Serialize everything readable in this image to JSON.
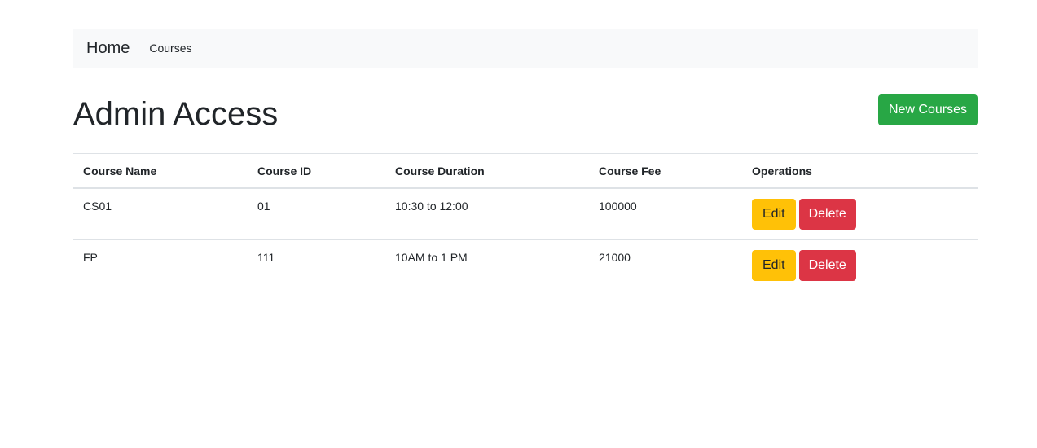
{
  "navbar": {
    "brand": "Home",
    "links": [
      "Courses"
    ]
  },
  "page": {
    "title": "Admin Access",
    "new_button": "New Courses"
  },
  "table": {
    "headers": [
      "Course Name",
      "Course ID",
      "Course Duration",
      "Course Fee",
      "Operations"
    ],
    "rows": [
      {
        "name": "CS01",
        "id": "01",
        "duration": "10:30 to 12:00",
        "fee": "100000"
      },
      {
        "name": "FP",
        "id": "111",
        "duration": "10AM to 1 PM",
        "fee": "21000"
      }
    ],
    "edit_label": "Edit",
    "delete_label": "Delete"
  },
  "colors": {
    "navbar_bg": "#f8f9fa",
    "success": "#28a745",
    "warning": "#ffc107",
    "danger": "#dc3545"
  }
}
